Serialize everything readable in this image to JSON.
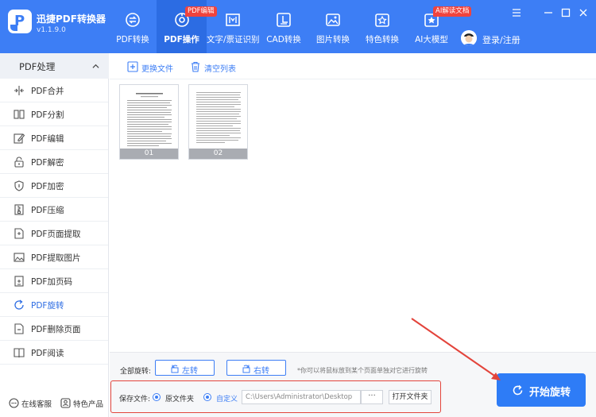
{
  "app": {
    "name": "迅捷PDF转换器",
    "version": "v1.1.9.0"
  },
  "nav": [
    {
      "label": "PDF转换",
      "icon": "convert-icon"
    },
    {
      "label": "PDF操作",
      "icon": "pdf-operate-icon",
      "badge": "PDF编辑",
      "active": true
    },
    {
      "label": "文字/票证识别",
      "icon": "ocr-icon"
    },
    {
      "label": "CAD转换",
      "icon": "cad-icon"
    },
    {
      "label": "图片转换",
      "icon": "image-icon"
    },
    {
      "label": "特色转换",
      "icon": "feature-icon"
    },
    {
      "label": "AI大模型",
      "icon": "ai-icon",
      "badge": "AI解读文档"
    }
  ],
  "user": {
    "login": "登录/注册"
  },
  "sidebar": {
    "title": "PDF处理",
    "items": [
      {
        "label": "PDF合并"
      },
      {
        "label": "PDF分割"
      },
      {
        "label": "PDF编辑"
      },
      {
        "label": "PDF解密"
      },
      {
        "label": "PDF加密"
      },
      {
        "label": "PDF压缩"
      },
      {
        "label": "PDF页面提取"
      },
      {
        "label": "PDF提取图片"
      },
      {
        "label": "PDF加页码"
      },
      {
        "label": "PDF旋转",
        "active": true
      },
      {
        "label": "PDF删除页面"
      },
      {
        "label": "PDF阅读"
      }
    ],
    "footer": [
      {
        "label": "在线客服"
      },
      {
        "label": "特色产品"
      }
    ]
  },
  "toolbar": {
    "replace_file": "更换文件",
    "clear_list": "清空列表"
  },
  "thumbnails": [
    {
      "label": "01"
    },
    {
      "label": "02"
    }
  ],
  "rotate": {
    "label": "全部旋转:",
    "left": "左转",
    "right": "右转",
    "hint": "*你可以将鼠标放到某个页面单独对它进行旋转"
  },
  "save": {
    "label": "保存文件:",
    "option_source": "原文件夹",
    "option_custom": "自定义",
    "path": "C:\\Users\\Administrator\\Desktop",
    "browse": "···",
    "open_folder": "打开文件夹"
  },
  "start_button": "开始旋转",
  "colors": {
    "brand": "#3d7ef5",
    "active_nav": "#2c6ce3",
    "badge": "#f0433d",
    "annotation": "#e3443b"
  }
}
